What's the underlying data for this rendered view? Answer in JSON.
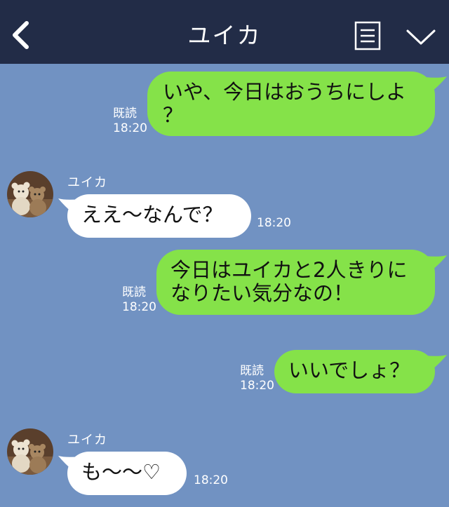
{
  "header": {
    "title": "ユイカ",
    "back_icon": "chevron-left-icon",
    "memo_icon": "notes-icon",
    "menu_icon": "chevron-down-icon"
  },
  "colors": {
    "header_bg": "#222c47",
    "chat_bg": "#7192c2",
    "outgoing_bubble": "#85e249",
    "incoming_bubble": "#ffffff"
  },
  "messages": [
    {
      "side": "out",
      "lines": [
        "いや、今日はおうちにしよ",
        "？"
      ],
      "read": "既読",
      "time": "18:20"
    },
    {
      "side": "in",
      "sender": "ユイカ",
      "lines": [
        "ええ〜なんで？"
      ],
      "time": "18:20"
    },
    {
      "side": "out",
      "lines": [
        "今日はユイカと2人きりに",
        "なりたい気分なの！"
      ],
      "read": "既読",
      "time": "18:20"
    },
    {
      "side": "out",
      "lines": [
        "いいでしょ？"
      ],
      "read": "既読",
      "time": "18:20"
    },
    {
      "side": "in",
      "sender": "ユイカ",
      "lines": [
        "も〜〜♡"
      ],
      "time": "18:20"
    }
  ]
}
